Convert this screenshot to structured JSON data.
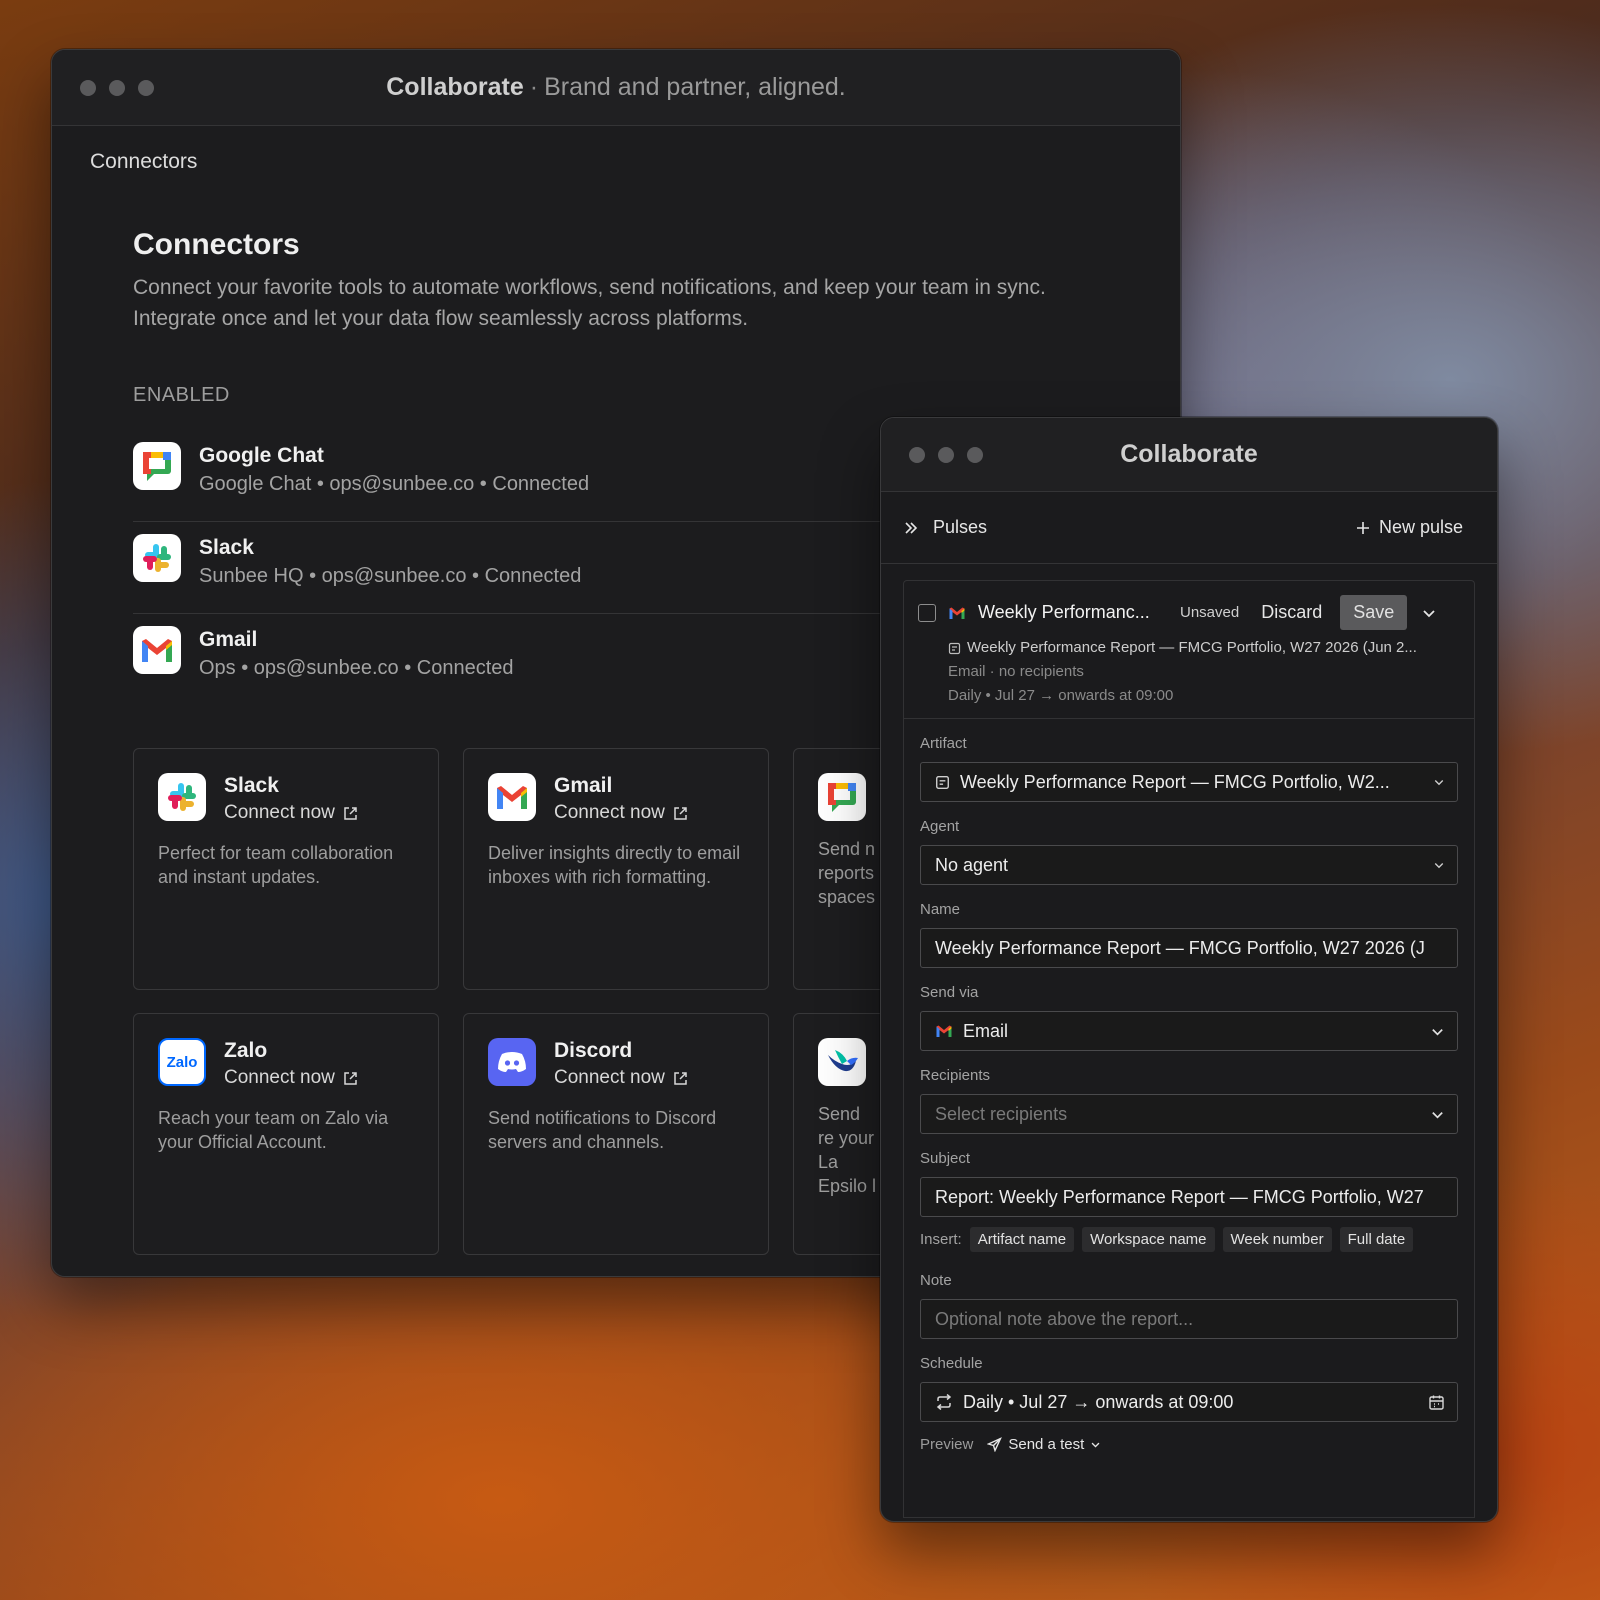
{
  "main_window": {
    "title_strong": "Collaborate",
    "title_sep": "·",
    "title_sub": "Brand and partner, aligned.",
    "breadcrumb": "Connectors",
    "heading": "Connectors",
    "description": "Connect your favorite tools to automate workflows, send notifications, and keep your team in sync. Integrate once and let your data flow seamlessly across platforms.",
    "enabled_label": "ENABLED",
    "enabled": [
      {
        "name": "Google Chat",
        "meta": "Google Chat • ops@sunbee.co • Connected",
        "icon": "google-chat-icon"
      },
      {
        "name": "Slack",
        "meta": "Sunbee HQ • ops@sunbee.co • Connected",
        "icon": "slack-icon"
      },
      {
        "name": "Gmail",
        "meta": "Ops • ops@sunbee.co • Connected",
        "icon": "gmail-icon"
      }
    ],
    "cards": [
      {
        "name": "Slack",
        "link": "Connect now",
        "desc": "Perfect for team collaboration and instant updates.",
        "icon": "slack-icon"
      },
      {
        "name": "Gmail",
        "link": "Connect now",
        "desc": "Deliver insights directly to email inboxes with rich formatting.",
        "icon": "gmail-icon"
      },
      {
        "name": "",
        "link": "",
        "desc": "Send n reports spaces",
        "icon": "google-chat-icon"
      },
      {
        "name": "Zalo",
        "link": "Connect now",
        "desc": "Reach your team on Zalo via your Official Account.",
        "icon": "zalo-icon"
      },
      {
        "name": "Discord",
        "link": "Connect now",
        "desc": "Send notifications to Discord servers and channels.",
        "icon": "discord-icon"
      },
      {
        "name": "",
        "link": "",
        "desc": "Send re your La Epsilo l",
        "icon": "lark-icon"
      }
    ]
  },
  "pulse_window": {
    "title": "Collaborate",
    "header": {
      "pulses_label": "Pulses",
      "new_pulse_label": "New pulse"
    },
    "pulse": {
      "title": "Weekly Performanc...",
      "status": "Unsaved",
      "discard_label": "Discard",
      "save_label": "Save",
      "artifact_line": "Weekly Performance Report — FMCG Portfolio, W27 2026 (Jun 2...",
      "channel_line": "Email · no recipients",
      "schedule_line": "Daily • Jul 27 → onwards at 09:00"
    },
    "form": {
      "artifact_label": "Artifact",
      "artifact_value": "Weekly Performance Report — FMCG Portfolio, W2...",
      "agent_label": "Agent",
      "agent_value": "No agent",
      "name_label": "Name",
      "name_value": "Weekly Performance Report — FMCG Portfolio, W27 2026 (J",
      "sendvia_label": "Send via",
      "sendvia_value": "Email",
      "recipients_label": "Recipients",
      "recipients_placeholder": "Select recipients",
      "subject_label": "Subject",
      "subject_value": "Report: Weekly Performance Report — FMCG Portfolio, W27",
      "insert_label": "Insert:",
      "insert_chips": [
        "Artifact name",
        "Workspace name",
        "Week number",
        "Full date"
      ],
      "note_label": "Note",
      "note_placeholder": "Optional note above the report...",
      "schedule_label": "Schedule",
      "schedule_value": "Daily • Jul 27 → onwards at 09:00",
      "preview_label": "Preview",
      "send_test_label": "Send a test"
    }
  },
  "colors": {
    "window_bg": "#1c1c1e",
    "border": "#343436",
    "save_bg": "#5a5a5c",
    "gmail_red": "#ea4335",
    "discord": "#5865f2",
    "zalo": "#0068ff"
  }
}
